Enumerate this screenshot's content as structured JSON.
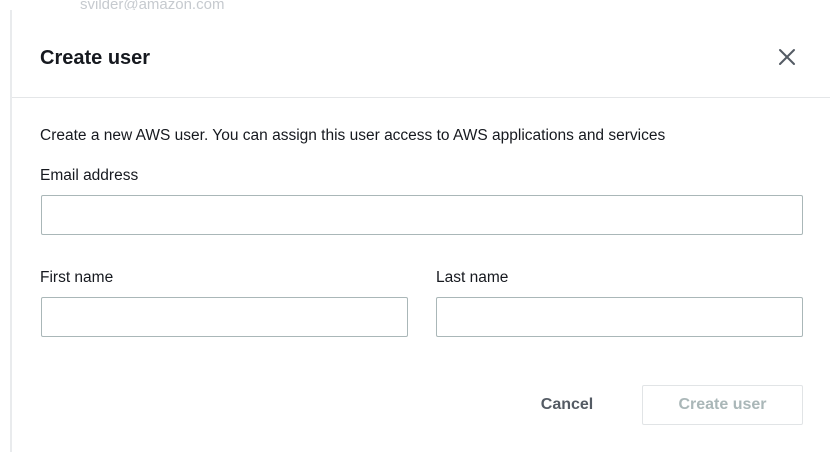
{
  "background": {
    "partial_text": "svilder@amazon.com"
  },
  "modal": {
    "title": "Create user",
    "close_icon": "close-icon",
    "description": "Create a new AWS user. You can assign this user access to AWS applications and services",
    "fields": {
      "email": {
        "label": "Email address",
        "value": "",
        "placeholder": ""
      },
      "first_name": {
        "label": "First name",
        "value": "",
        "placeholder": ""
      },
      "last_name": {
        "label": "Last name",
        "value": "",
        "placeholder": ""
      }
    },
    "buttons": {
      "cancel": "Cancel",
      "create": "Create user"
    }
  },
  "colors": {
    "text": "#16191f",
    "border": "#aab7b8",
    "disabled_text": "#aab7b8",
    "divider": "#e4e6e8"
  }
}
